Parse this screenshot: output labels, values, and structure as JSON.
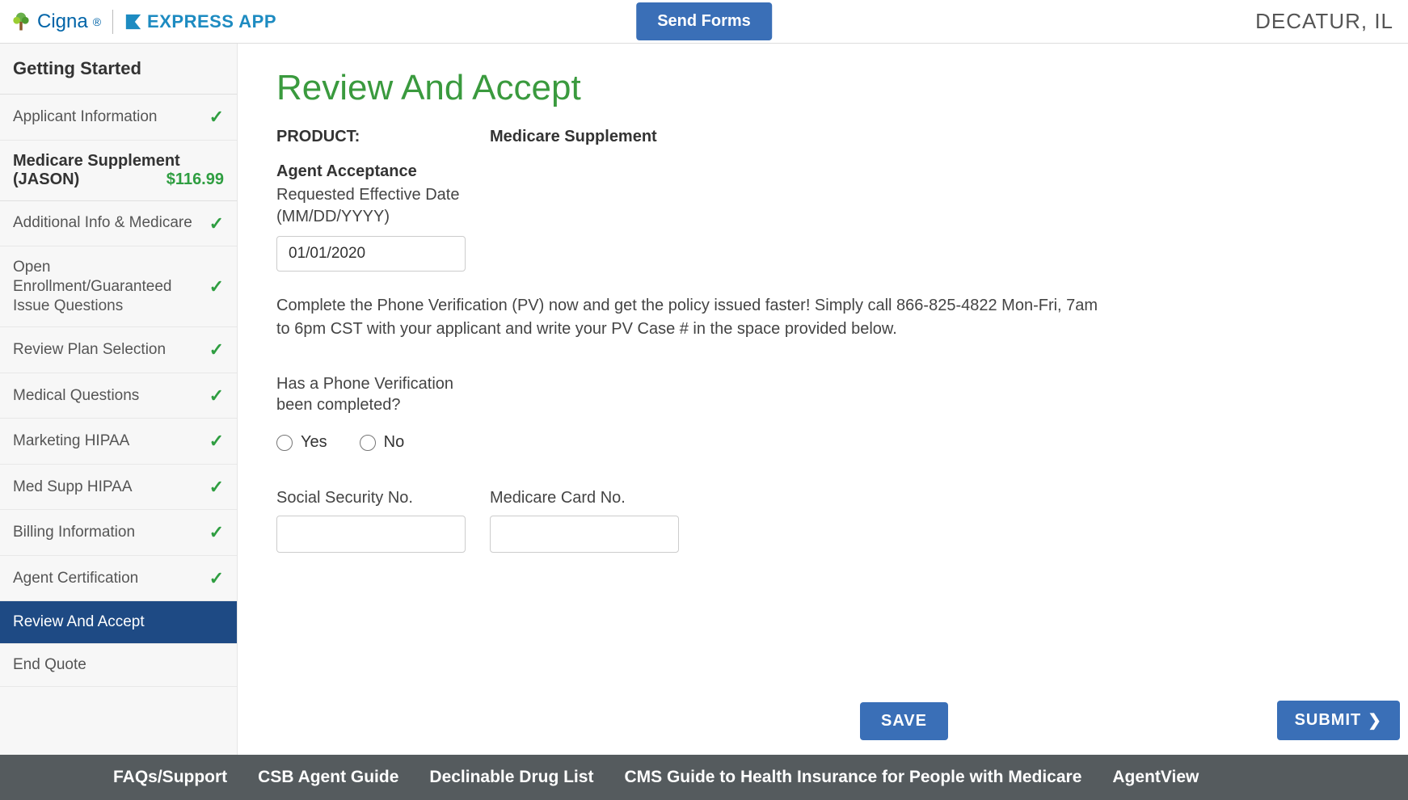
{
  "header": {
    "brand_primary": "Cigna",
    "brand_secondary": "EXPRESS APP",
    "send_forms_label": "Send Forms",
    "location": "DECATUR, IL"
  },
  "sidebar": {
    "heading": "Getting Started",
    "product": {
      "line1": "Medicare Supplement",
      "line2": "(JASON)",
      "price": "$116.99"
    },
    "items": [
      {
        "label": "Applicant Information",
        "completed": true,
        "active": false
      },
      {
        "label": "Additional Info & Medicare",
        "completed": true,
        "active": false
      },
      {
        "label": "Open Enrollment/Guaranteed Issue Questions",
        "completed": true,
        "active": false
      },
      {
        "label": "Review Plan Selection",
        "completed": true,
        "active": false
      },
      {
        "label": "Medical Questions",
        "completed": true,
        "active": false
      },
      {
        "label": "Marketing HIPAA",
        "completed": true,
        "active": false
      },
      {
        "label": "Med Supp HIPAA",
        "completed": true,
        "active": false
      },
      {
        "label": "Billing Information",
        "completed": true,
        "active": false
      },
      {
        "label": "Agent Certification",
        "completed": true,
        "active": false
      },
      {
        "label": "Review And Accept",
        "completed": false,
        "active": true
      },
      {
        "label": "End Quote",
        "completed": false,
        "active": false
      }
    ]
  },
  "main": {
    "title": "Review And Accept",
    "product_label": "PRODUCT:",
    "product_value": "Medicare Supplement",
    "agent_acceptance_heading": "Agent Acceptance",
    "requested_date_label": "Requested Effective Date (MM/DD/YYYY)",
    "requested_date_value": "01/01/2020",
    "pv_paragraph": "Complete the Phone Verification (PV) now and get the policy issued faster! Simply call 866-825-4822 Mon-Fri, 7am to 6pm CST with your applicant and write your PV Case # in the space provided below.",
    "pv_question": "Has a Phone Verification been completed?",
    "radio_yes": "Yes",
    "radio_no": "No",
    "ssn_label": "Social Security No.",
    "ssn_value": "",
    "medicare_label": "Medicare Card No.",
    "medicare_value": "",
    "save_label": "SAVE",
    "submit_label": "SUBMIT"
  },
  "footer": {
    "links": [
      "FAQs/Support",
      "CSB Agent Guide",
      "Declinable Drug List",
      "CMS Guide to Health Insurance for People with Medicare",
      "AgentView"
    ]
  }
}
